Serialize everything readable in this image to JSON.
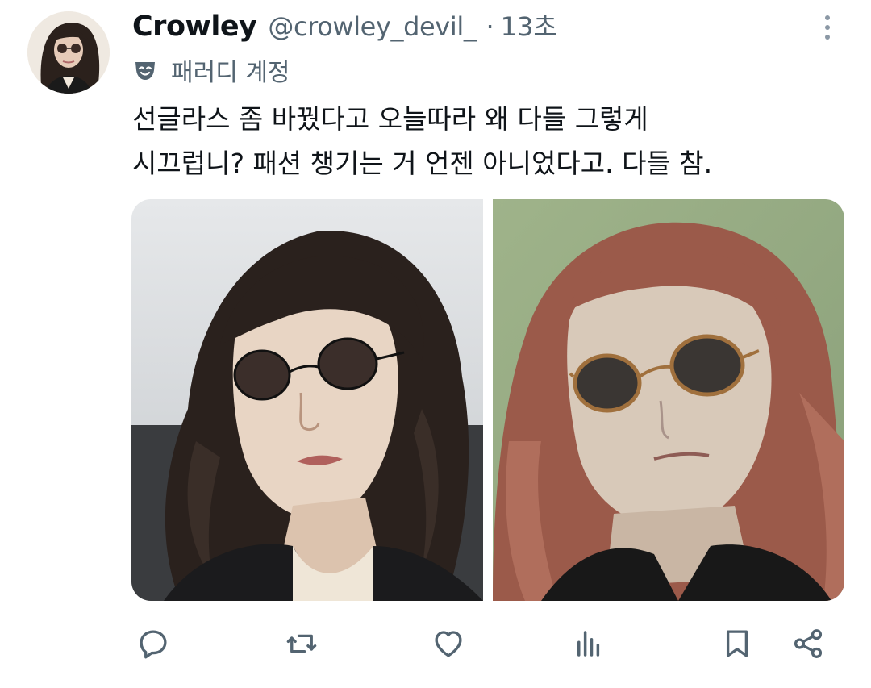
{
  "author": {
    "name": "Crowley",
    "handle": "@crowley_devil_",
    "separator": "·",
    "time": "13초",
    "label": "패러디 계정",
    "label_icon": "parody-mask-icon"
  },
  "tweet": {
    "lines": [
      "선글라스 좀 바꿨다고 오늘따라 왜 다들 그렇게",
      "시끄럽니? 패션 챙기는 거 언젠 아니었다고. 다들 참."
    ]
  },
  "media": {
    "photos": [
      {
        "subject": "person-long-dark-curly-hair-round-sunglasses"
      },
      {
        "subject": "person-long-auburn-hair-round-sunglasses"
      }
    ]
  },
  "actions": [
    {
      "name": "reply-icon"
    },
    {
      "name": "retweet-icon"
    },
    {
      "name": "like-icon"
    },
    {
      "name": "views-icon"
    },
    {
      "name": "bookmark-icon"
    },
    {
      "name": "share-icon"
    }
  ],
  "colors": {
    "text_primary": "#0f1419",
    "text_secondary": "#536471",
    "icon_gray": "#536471"
  }
}
